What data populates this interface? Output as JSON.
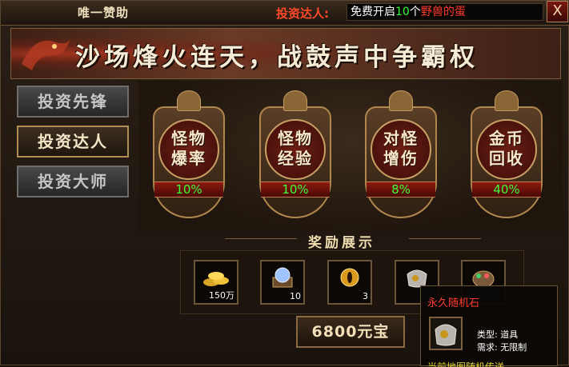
{
  "window": {
    "title": "唯一赞助",
    "close_label": "X"
  },
  "promo": {
    "label": "投资达人:",
    "text_before": "免费开启",
    "count": "10",
    "text_unit": "个",
    "item": "野兽的蛋"
  },
  "banner": {
    "slogan": "沙场烽火连天，战鼓声中争霸权"
  },
  "tabs": [
    {
      "label": "投资先锋",
      "active": false
    },
    {
      "label": "投资达人",
      "active": true
    },
    {
      "label": "投资大师",
      "active": false
    }
  ],
  "stats": [
    {
      "line1": "怪物",
      "line2": "爆率",
      "value": "10%"
    },
    {
      "line1": "怪物",
      "line2": "经验",
      "value": "10%"
    },
    {
      "line1": "对怪",
      "line2": "增伤",
      "value": "8%"
    },
    {
      "line1": "金币",
      "line2": "回收",
      "value": "40%"
    }
  ],
  "rewards": {
    "title": "奖励展示",
    "items": [
      {
        "icon": "gold-coins-icon",
        "qty": "150万"
      },
      {
        "icon": "crystal-chest-icon",
        "qty": "10"
      },
      {
        "icon": "golden-eye-token-icon",
        "qty": "3"
      },
      {
        "icon": "random-stone-icon",
        "qty": ""
      },
      {
        "icon": "gem-pouch-icon",
        "qty": ""
      }
    ]
  },
  "price": {
    "label": "6800元宝"
  },
  "tooltip": {
    "name": "永久随机石",
    "type": "类型: 道具",
    "requirement": "需求: 无限制",
    "description_cut": "当前地图随机传送"
  },
  "colors": {
    "highlight_green": "#33ff33",
    "highlight_red": "#ff3b2a",
    "gold_border": "#b2874d"
  }
}
